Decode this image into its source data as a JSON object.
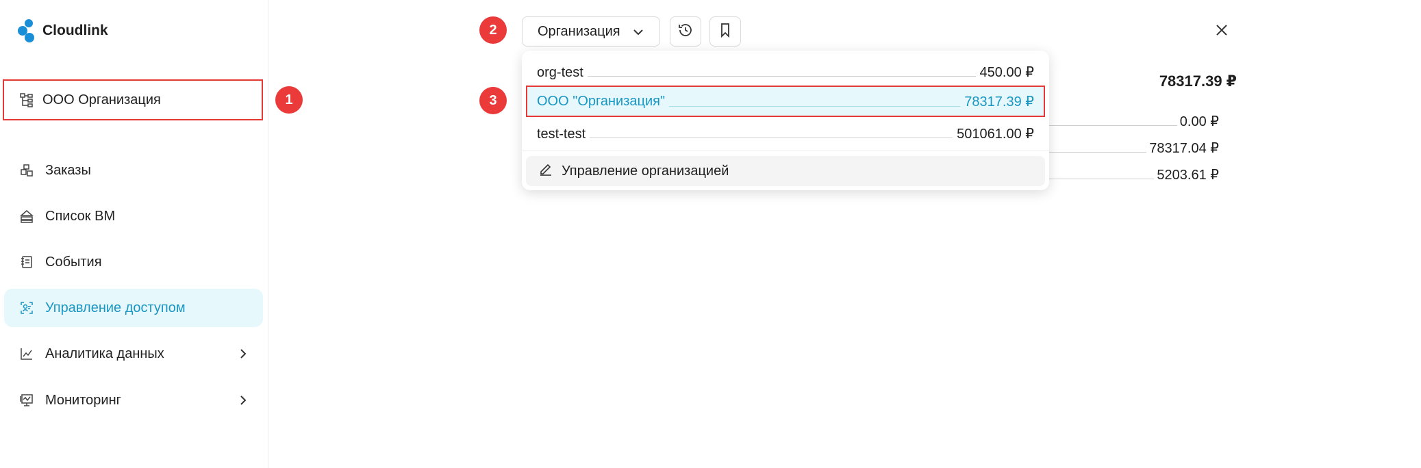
{
  "app": {
    "name": "Cloudlink",
    "brand_color": "#1a8fd8"
  },
  "sidebar": {
    "org": {
      "label": "ООО Организация",
      "icon": "hierarchy-icon"
    },
    "items": [
      {
        "label": "Заказы",
        "icon": "orders-icon"
      },
      {
        "label": "Список ВМ",
        "icon": "vm-list-icon"
      },
      {
        "label": "События",
        "icon": "events-icon"
      },
      {
        "label": "Управление доступом",
        "icon": "access-icon",
        "active": true
      },
      {
        "label": "Аналитика данных",
        "icon": "analytics-icon",
        "has_submenu": true
      },
      {
        "label": "Мониторинг",
        "icon": "monitoring-icon",
        "has_submenu": true
      }
    ]
  },
  "toolbar": {
    "org_select_label": "Организация",
    "history_icon": "history-icon",
    "bookmark_icon": "bookmark-icon",
    "close_icon": "close-icon"
  },
  "balance": {
    "total": "78317.39 ₽",
    "rows": [
      "0.00 ₽",
      "78317.04 ₽",
      "5203.61 ₽"
    ]
  },
  "dropdown": {
    "options": [
      {
        "name": "org-test",
        "value": "450.00 ₽"
      },
      {
        "name": "ООО \"Организация\"",
        "value": "78317.39 ₽",
        "selected": true
      },
      {
        "name": "test-test",
        "value": "501061.00 ₽"
      }
    ],
    "manage_label": "Управление организацией",
    "accent_color": "#1a96c3"
  },
  "markers": [
    "1",
    "2",
    "3"
  ],
  "highlight_color": "#e53935"
}
